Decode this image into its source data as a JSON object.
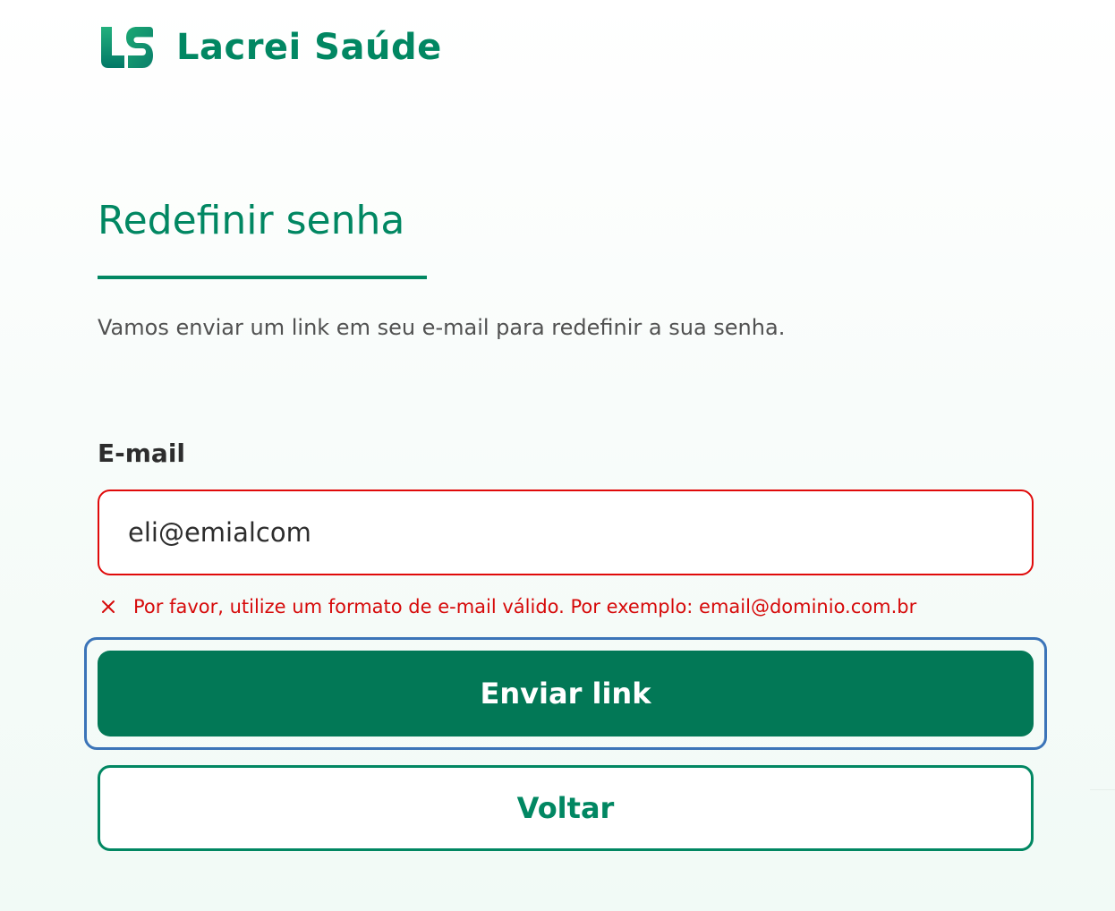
{
  "brand": {
    "name": "Lacrei Saúde",
    "logo_icon": "ls-monogram-icon",
    "color": "#018762"
  },
  "page": {
    "title": "Redefinir senha",
    "subtitle": "Vamos enviar um link em seu e-mail para redefinir a sua senha."
  },
  "form": {
    "email_label": "E-mail",
    "email_value": "eli@emialcom",
    "error_icon": "close-x-icon",
    "error_message": "Por favor, utilize um formato de e-mail válido. Por exemplo: email@dominio.com.br",
    "error_color": "#d60a0a"
  },
  "actions": {
    "submit_label": "Enviar link",
    "back_label": "Voltar",
    "submit_color": "#027856",
    "focus_color": "#3b74b8"
  }
}
